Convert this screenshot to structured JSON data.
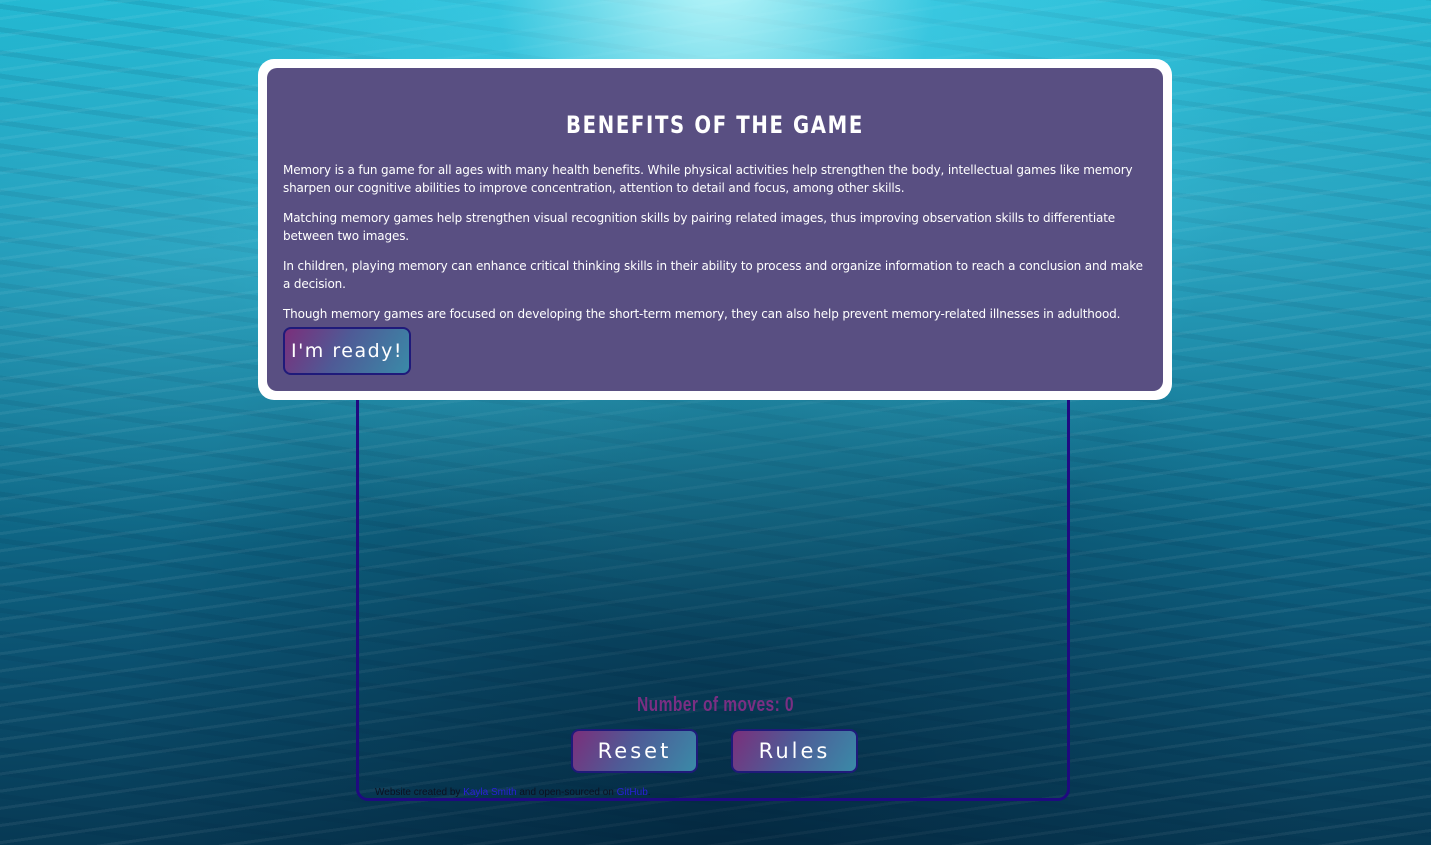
{
  "modal": {
    "title": "BENEFITS OF THE GAME",
    "paragraphs": [
      "Memory is a fun game for all ages with many health benefits. While physical activities help strengthen the body, intellectual games like memory sharpen our cognitive abilities to improve concentration, attention to detail and focus, among other skills.",
      "Matching memory games help strengthen visual recognition skills by pairing related images, thus improving observation skills to differentiate between two images.",
      "In children, playing memory can enhance critical thinking skills in their ability to process and organize information to reach a conclusion and make a decision.",
      "Though memory games are focused on developing the short-term memory, they can also help prevent memory-related illnesses in adulthood."
    ],
    "ready_label": "I'm ready!"
  },
  "game": {
    "moves_text": "Number of moves: 0",
    "reset_label": "Reset",
    "rules_label": "Rules"
  },
  "footer": {
    "prefix": "Website created by ",
    "author_link": "Kayla Smith",
    "middle": " and open-sourced on ",
    "repo_link": "GitHub",
    "suffix": "."
  },
  "colors": {
    "modal_background": "#594f82",
    "board_border": "#1f0a80",
    "moves_text": "#7a2f83",
    "link": "#2a20d8"
  }
}
